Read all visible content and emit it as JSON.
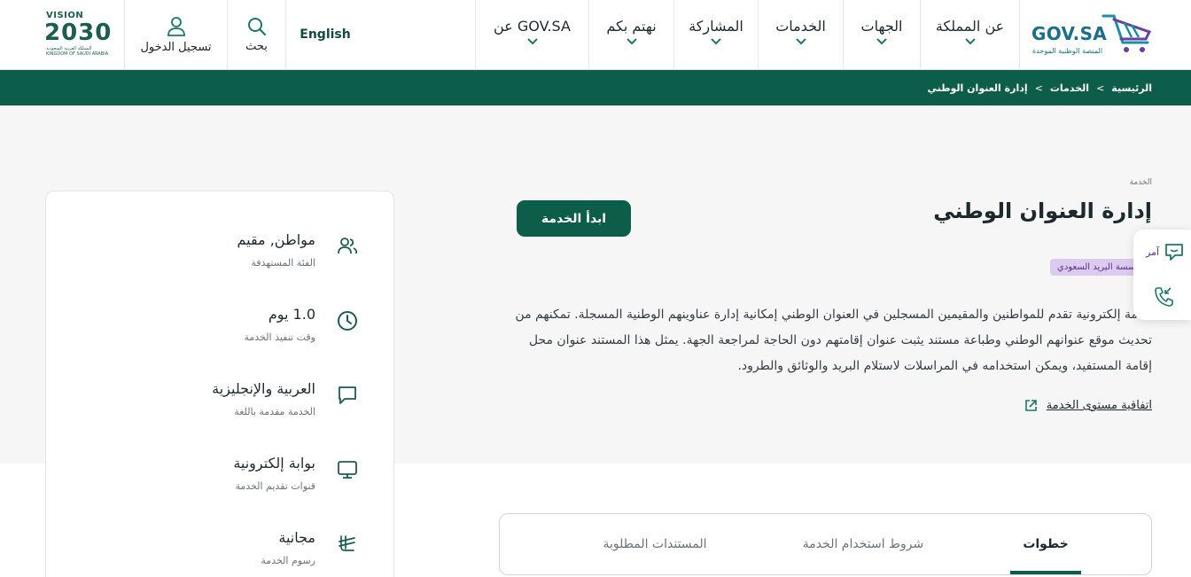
{
  "header": {
    "vision": {
      "label": "VISION",
      "year": "2030",
      "kingdom": "المملكة العربية السعودية KINGDOM OF SAUDI ARABIA"
    },
    "login_label": "تسجيل الدخول",
    "search_label": "بحث",
    "language_label": "English",
    "nav": [
      {
        "label": "عن GOV.SA"
      },
      {
        "label": "نهتم بكم"
      },
      {
        "label": "المشاركة"
      },
      {
        "label": "الخدمات"
      },
      {
        "label": "الجهات"
      },
      {
        "label": "عن المملكة"
      }
    ],
    "logo": {
      "title": "GOV.SA",
      "subtitle": "المنصة الوطنية الموحدة"
    }
  },
  "breadcrumb": {
    "home": "الرئيسية",
    "services": "الخدمات",
    "current": "إدارة العنوان الوطني",
    "separator": ">"
  },
  "service": {
    "caption": "الخدمة",
    "title": "إدارة العنوان الوطني",
    "start_label": "ابدأ الخدمة",
    "agency": "مؤسسة البريد السعودي",
    "description": "خدمة إلكترونية تقدم للمواطنين والمقيمين المسجلين في العنوان الوطني إمكانية إدارة عناوينهم الوطنية المسجلة. تمكنهم من تحديث موقع عنوانهم الوطني وطباعة مستند يثبت عنوان إقامتهم دون الحاجة لمراجعة الجهة. يمثل هذا المستند عنوان محل إقامة المستفيد، ويمكن استخدامه في المراسلات لاستلام البريد والوثائق والطرود.",
    "sla_label": "اتفاقية مستوى الخدمة"
  },
  "floating": {
    "chat_label": "آمر"
  },
  "info": [
    {
      "value": "مواطن, مقيم",
      "key": "الفئة المستهدفة",
      "icon": "users-icon"
    },
    {
      "value": "1.0 يوم",
      "key": "وقت تنفيذ الخدمة",
      "icon": "clock-icon"
    },
    {
      "value": "العربية والإنجليزية",
      "key": "الخدمة مقدمة باللغة",
      "icon": "chat-bubble-icon"
    },
    {
      "value": "بوابة إلكترونية",
      "key": "قنوات تقديم الخدمة",
      "icon": "monitor-icon"
    },
    {
      "value": "مجانية",
      "key": "رسوم الخدمة",
      "icon": "riyal-icon"
    }
  ],
  "tabs": [
    {
      "label": "خطوات",
      "active": true
    },
    {
      "label": "شروط استخدام الخدمة",
      "active": false
    },
    {
      "label": "المستندات المطلوبة",
      "active": false
    }
  ],
  "colors": {
    "primary": "#0c5e4b",
    "badge_bg": "#dbcbee",
    "badge_fg": "#5a2f8f",
    "logo": "#1a6f8a"
  }
}
